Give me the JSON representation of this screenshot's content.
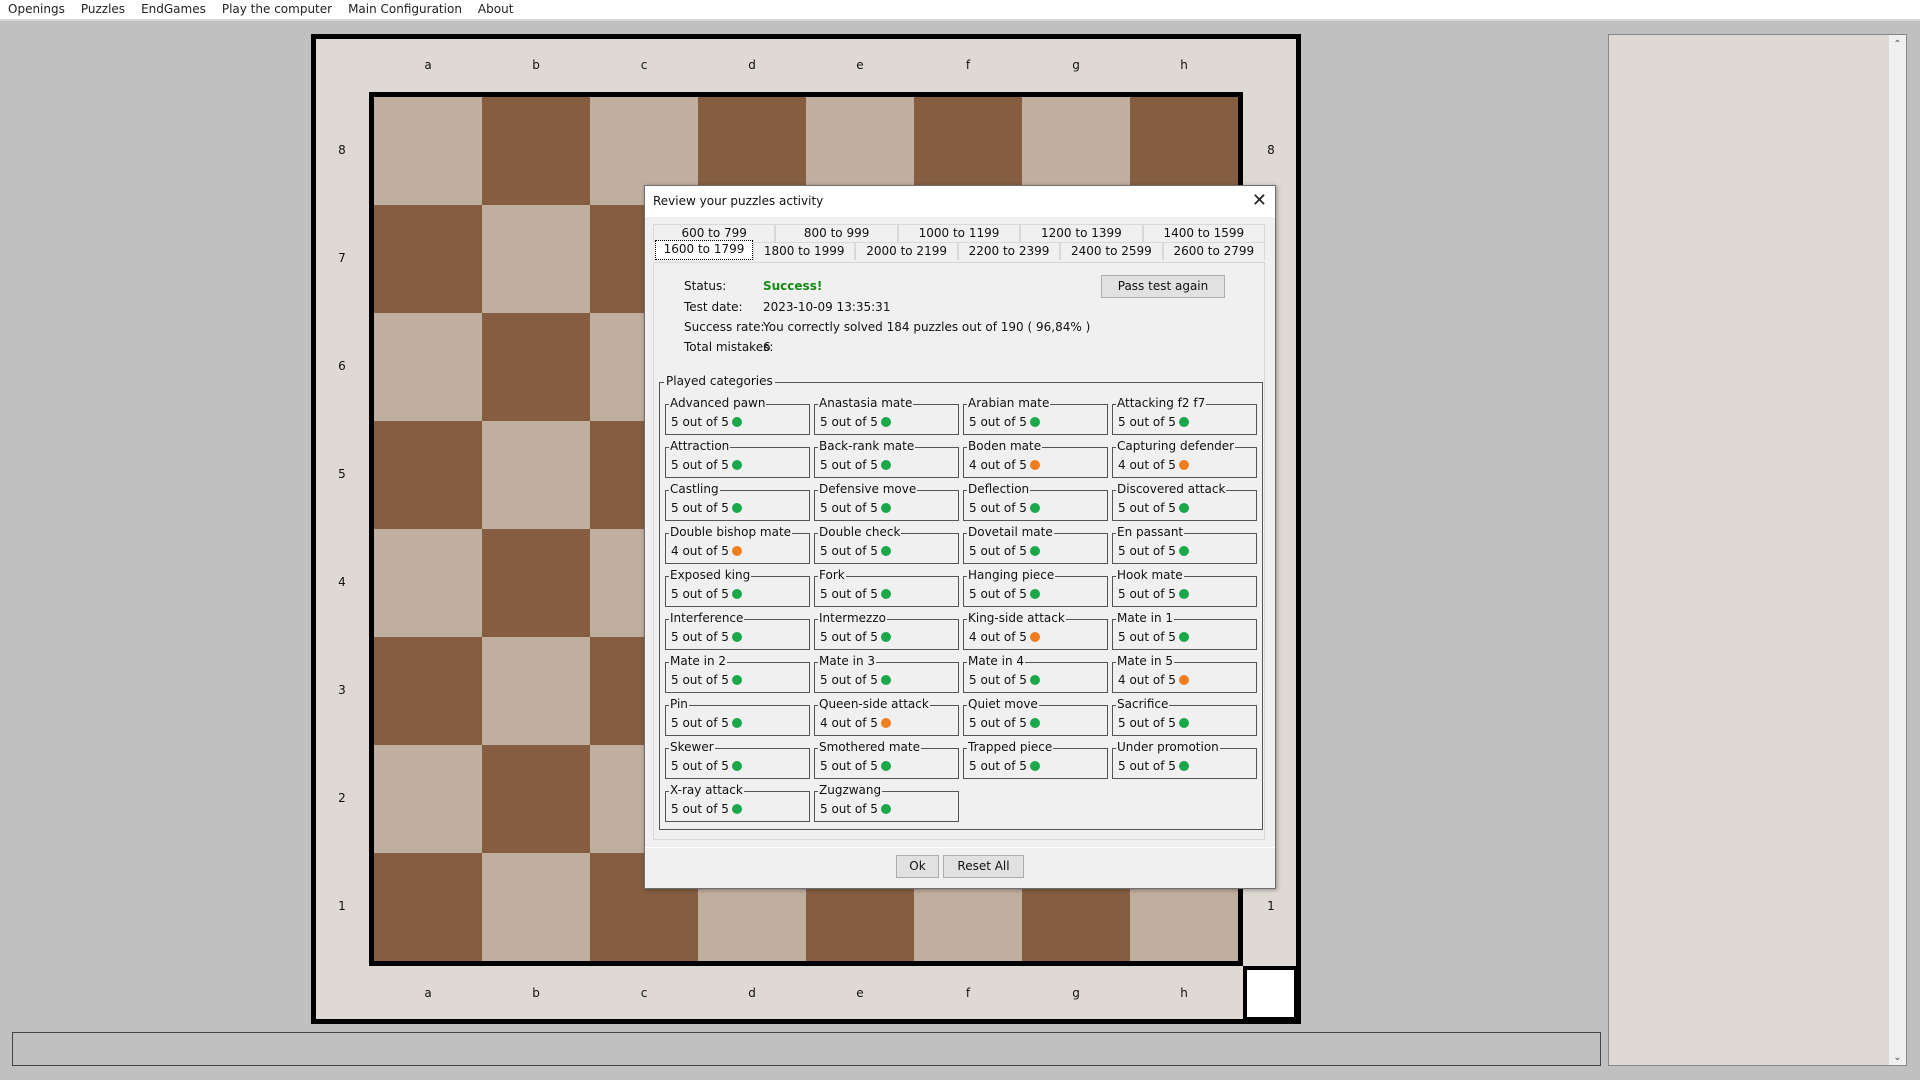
{
  "menu": [
    "Openings",
    "Puzzles",
    "EndGames",
    "Play the computer",
    "Main Configuration",
    "About"
  ],
  "board": {
    "files": [
      "a",
      "b",
      "c",
      "d",
      "e",
      "f",
      "g",
      "h"
    ],
    "ranks": [
      "8",
      "7",
      "6",
      "5",
      "4",
      "3",
      "2",
      "1"
    ],
    "colors": {
      "light": "#c0ae9e",
      "dark": "#855e42"
    }
  },
  "dialog": {
    "title": "Review your puzzles activity",
    "close_icon": "close-icon",
    "tabs_row1": [
      "600 to 799",
      "800 to 999",
      "1000 to 1199",
      "1200 to 1399",
      "1400 to 1599"
    ],
    "tabs_row2": [
      "1600 to 1799",
      "1800 to 1999",
      "2000 to 2199",
      "2200 to 2399",
      "2400 to 2599",
      "2600 to 2799"
    ],
    "active_tab": "1600 to 1799",
    "status_label": "Status:",
    "status_value": "Success!",
    "test_date_label": "Test date:",
    "test_date_value": "2023-10-09 13:35:31",
    "success_rate_label": "Success rate:",
    "success_rate_value": "You correctly solved 184 puzzles out of 190 ( 96,84% )",
    "mistakes_label": "Total mistakes:",
    "mistakes_value": "6",
    "pass_again_button": "Pass test again",
    "categories_title": "Played categories",
    "status_colors": {
      "full": "#1aa84a",
      "partial": "#f07d1e"
    },
    "categories": [
      {
        "name": "Advanced pawn",
        "score": "5 out of 5",
        "status": "full"
      },
      {
        "name": "Anastasia mate",
        "score": "5 out of 5",
        "status": "full"
      },
      {
        "name": "Arabian mate",
        "score": "5 out of 5",
        "status": "full"
      },
      {
        "name": "Attacking f2 f7",
        "score": "5 out of 5",
        "status": "full"
      },
      {
        "name": "Attraction",
        "score": "5 out of 5",
        "status": "full"
      },
      {
        "name": "Back-rank mate",
        "score": "5 out of 5",
        "status": "full"
      },
      {
        "name": "Boden mate",
        "score": "4 out of 5",
        "status": "partial"
      },
      {
        "name": "Capturing defender",
        "score": "4 out of 5",
        "status": "partial"
      },
      {
        "name": "Castling",
        "score": "5 out of 5",
        "status": "full"
      },
      {
        "name": "Defensive move",
        "score": "5 out of 5",
        "status": "full"
      },
      {
        "name": "Deflection",
        "score": "5 out of 5",
        "status": "full"
      },
      {
        "name": "Discovered attack",
        "score": "5 out of 5",
        "status": "full"
      },
      {
        "name": "Double bishop mate",
        "score": "4 out of 5",
        "status": "partial"
      },
      {
        "name": "Double check",
        "score": "5 out of 5",
        "status": "full"
      },
      {
        "name": "Dovetail mate",
        "score": "5 out of 5",
        "status": "full"
      },
      {
        "name": "En passant",
        "score": "5 out of 5",
        "status": "full"
      },
      {
        "name": "Exposed king",
        "score": "5 out of 5",
        "status": "full"
      },
      {
        "name": "Fork",
        "score": "5 out of 5",
        "status": "full"
      },
      {
        "name": "Hanging piece",
        "score": "5 out of 5",
        "status": "full"
      },
      {
        "name": "Hook mate",
        "score": "5 out of 5",
        "status": "full"
      },
      {
        "name": "Interference",
        "score": "5 out of 5",
        "status": "full"
      },
      {
        "name": "Intermezzo",
        "score": "5 out of 5",
        "status": "full"
      },
      {
        "name": "King-side attack",
        "score": "4 out of 5",
        "status": "partial"
      },
      {
        "name": "Mate in 1",
        "score": "5 out of 5",
        "status": "full"
      },
      {
        "name": "Mate in 2",
        "score": "5 out of 5",
        "status": "full"
      },
      {
        "name": "Mate in 3",
        "score": "5 out of 5",
        "status": "full"
      },
      {
        "name": "Mate in 4",
        "score": "5 out of 5",
        "status": "full"
      },
      {
        "name": "Mate in 5",
        "score": "4 out of 5",
        "status": "partial"
      },
      {
        "name": "Pin",
        "score": "5 out of 5",
        "status": "full"
      },
      {
        "name": "Queen-side attack",
        "score": "4 out of 5",
        "status": "partial"
      },
      {
        "name": "Quiet move",
        "score": "5 out of 5",
        "status": "full"
      },
      {
        "name": "Sacrifice",
        "score": "5 out of 5",
        "status": "full"
      },
      {
        "name": "Skewer",
        "score": "5 out of 5",
        "status": "full"
      },
      {
        "name": "Smothered mate",
        "score": "5 out of 5",
        "status": "full"
      },
      {
        "name": "Trapped piece",
        "score": "5 out of 5",
        "status": "full"
      },
      {
        "name": "Under promotion",
        "score": "5 out of 5",
        "status": "full"
      },
      {
        "name": "X-ray attack",
        "score": "5 out of 5",
        "status": "full"
      },
      {
        "name": "Zugzwang",
        "score": "5 out of 5",
        "status": "full"
      }
    ],
    "ok_button": "Ok",
    "reset_button": "Reset All"
  },
  "side_panel": {
    "scroll_up_icon": "chevron-up-icon",
    "scroll_down_icon": "chevron-down-icon"
  },
  "statusbar": {
    "text": ""
  }
}
